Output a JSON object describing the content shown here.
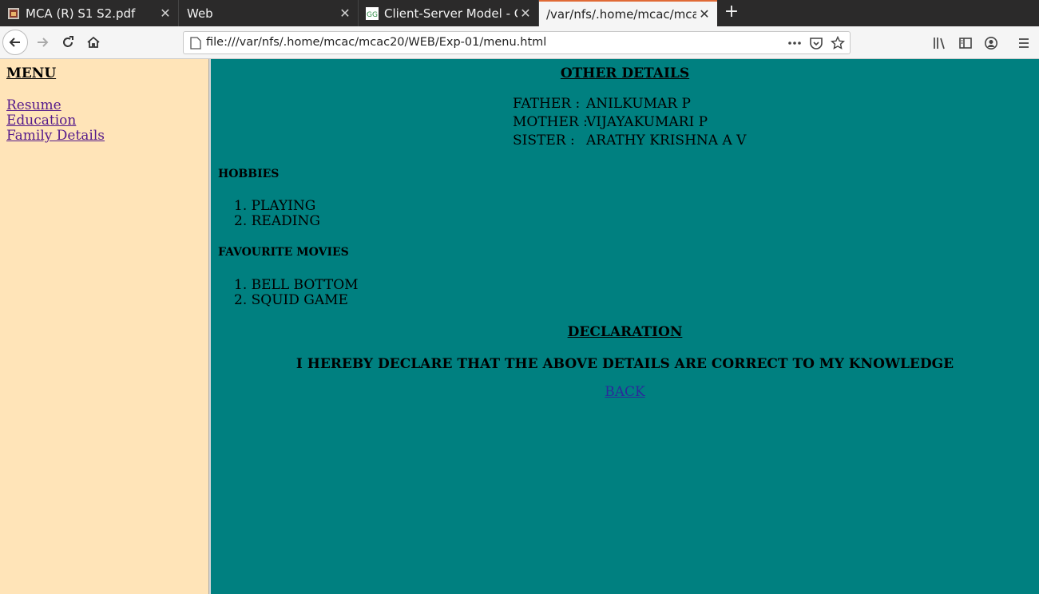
{
  "tabs": [
    {
      "label": "MCA (R) S1 S2.pdf",
      "icon": "pdf-icon"
    },
    {
      "label": "Web",
      "icon": ""
    },
    {
      "label": "Client-Server Model - Ge",
      "icon": "geeks-icon"
    },
    {
      "label": "/var/nfs/.home/mcac/mcac",
      "icon": ""
    }
  ],
  "url": "file:///var/nfs/.home/mcac/mcac20/WEB/Exp-01/menu.html",
  "menu": {
    "title": "MENU",
    "links": [
      "Resume",
      "Education",
      "Family Details"
    ]
  },
  "other_details": {
    "heading": "OTHER DETAILS",
    "family": [
      {
        "label": "FATHER :",
        "value": "ANILKUMAR P"
      },
      {
        "label": "MOTHER :",
        "value": "VIJAYAKUMARI P"
      },
      {
        "label": "SISTER :",
        "value": "ARATHY KRISHNA A V"
      }
    ]
  },
  "hobbies": {
    "heading": "HOBBIES",
    "items": [
      "1. PLAYING",
      "2. READING"
    ]
  },
  "movies": {
    "heading": "FAVOURITE MOVIES",
    "items": [
      "1. BELL BOTTOM",
      "2. SQUID GAME"
    ]
  },
  "declaration": {
    "heading": "DECLARATION",
    "text": "I HEREBY DECLARE THAT THE ABOVE DETAILS ARE CORRECT TO MY KNOWLEDGE",
    "back_label": "BACK"
  },
  "colors": {
    "left_frame_bg": "#ffe4b8",
    "right_frame_bg": "#008080",
    "active_tab_accent": "#e06a36",
    "link_color": "#551a8b"
  }
}
